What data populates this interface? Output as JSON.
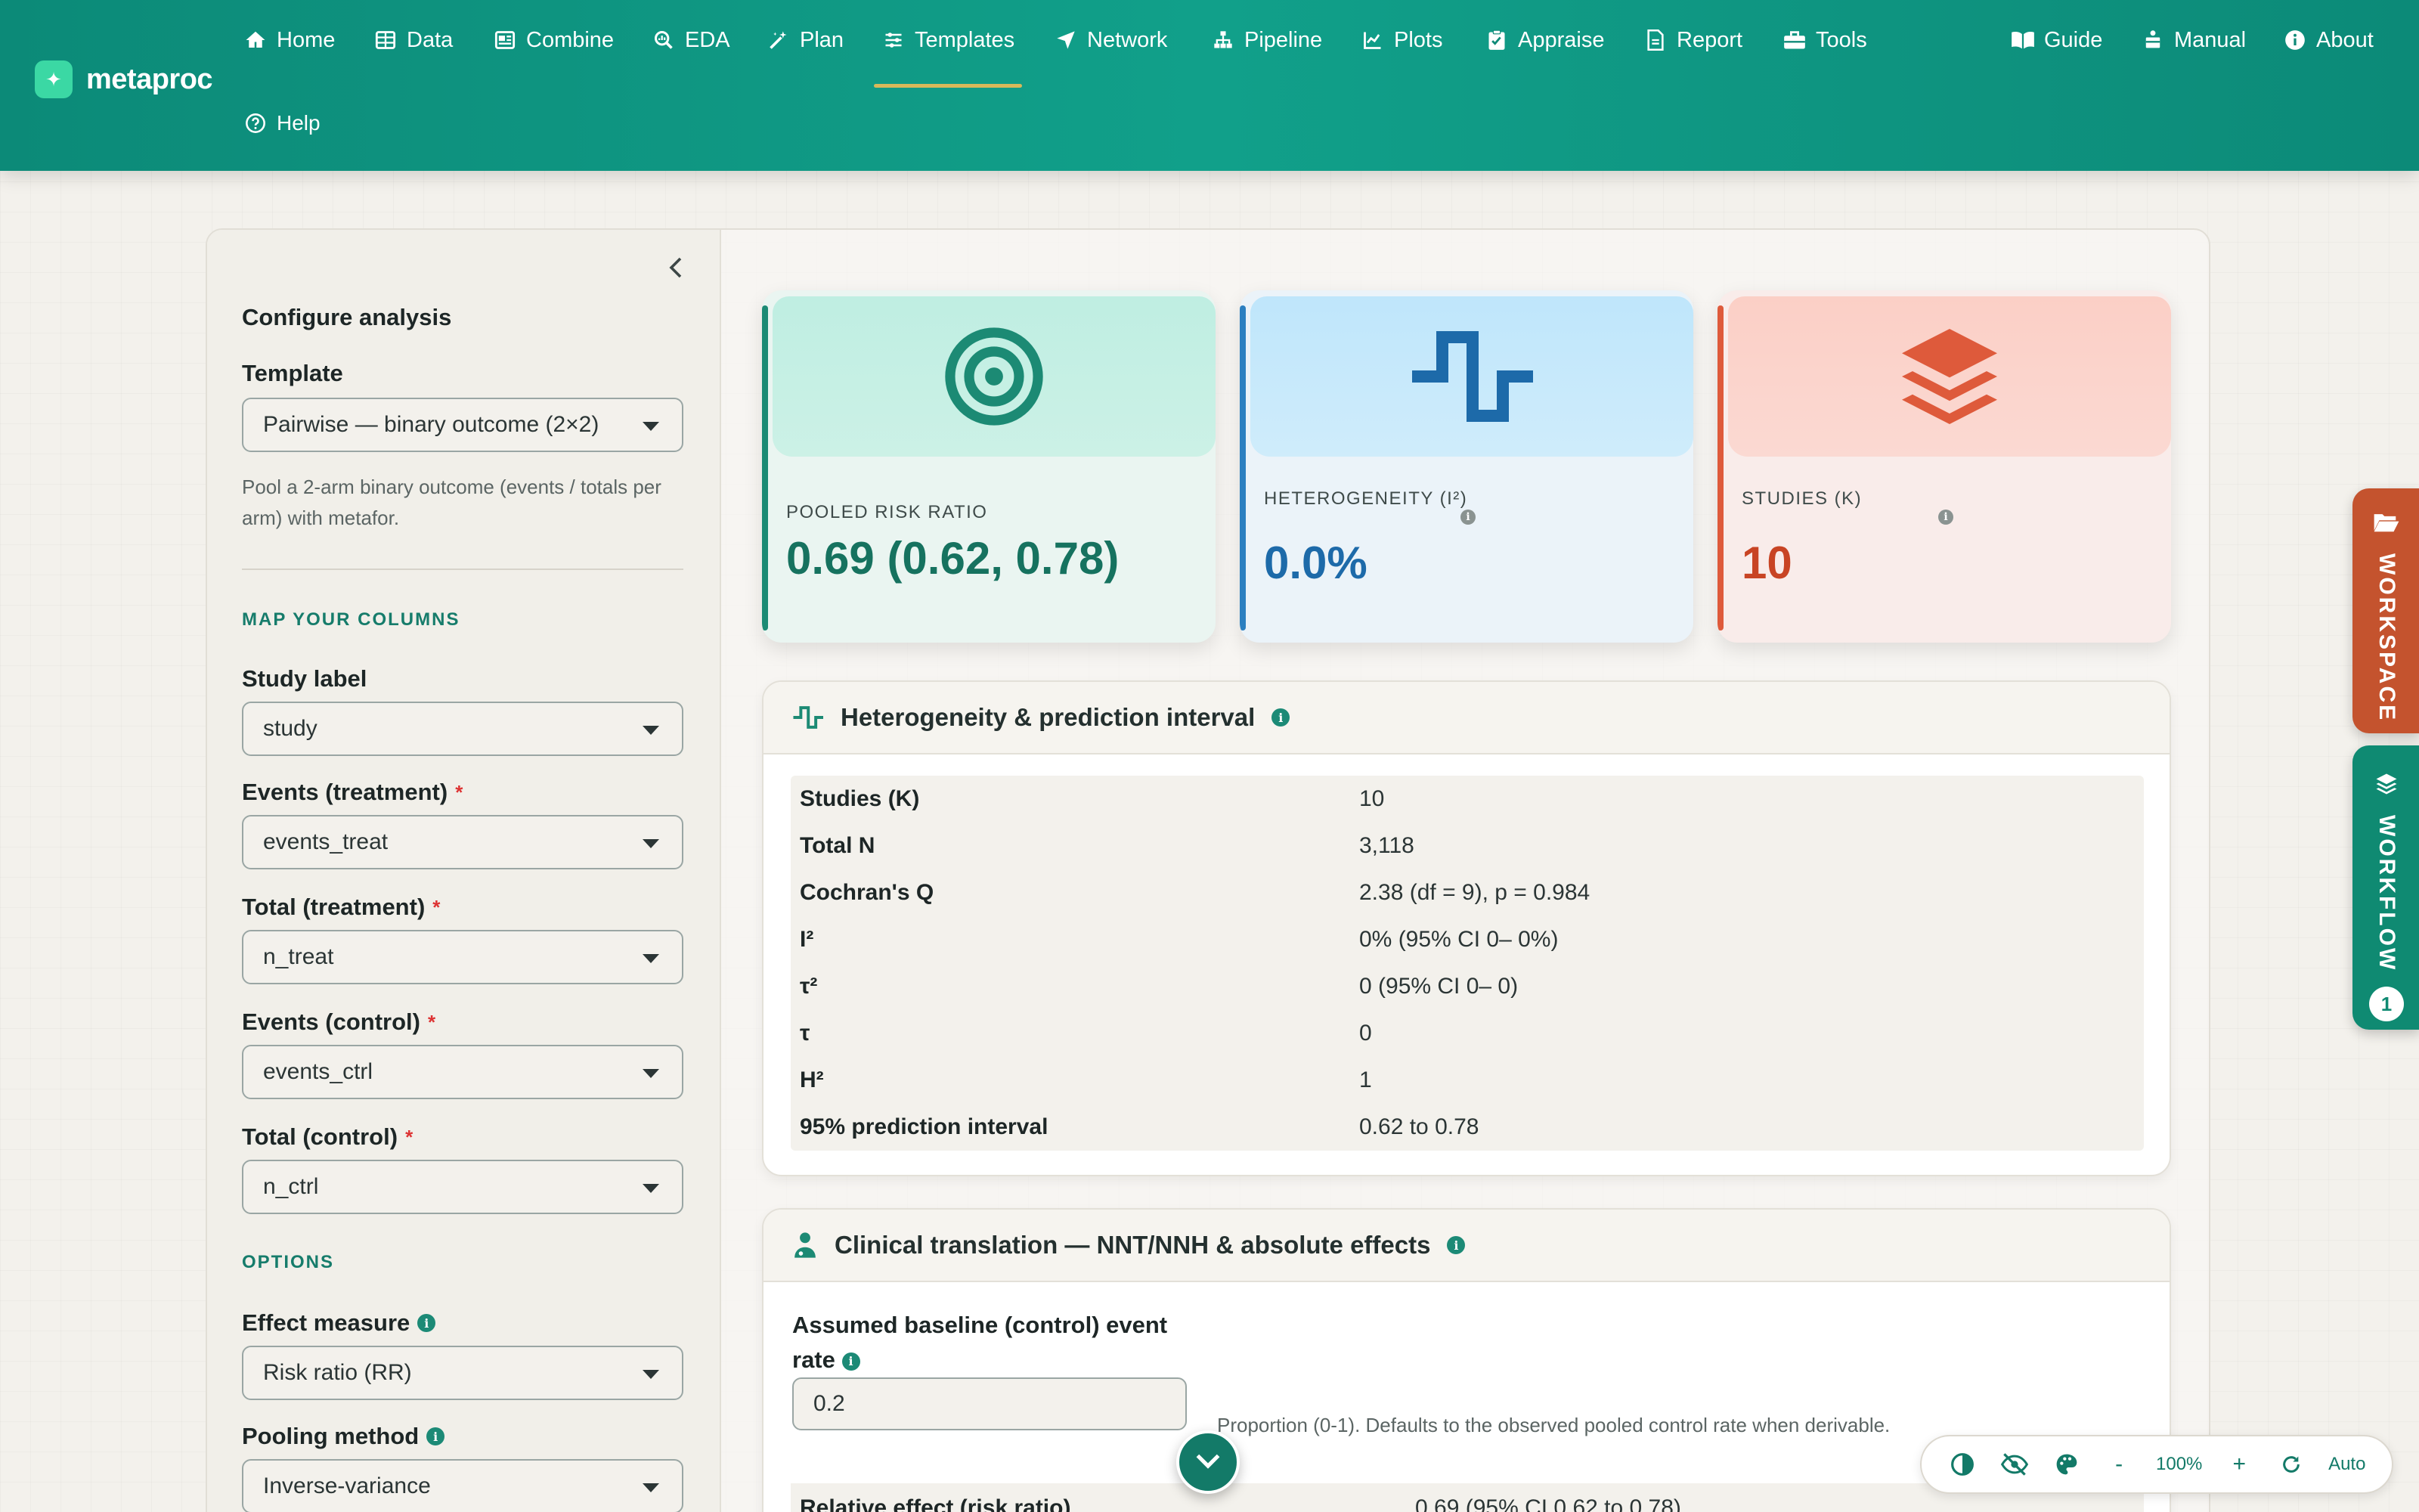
{
  "brand": {
    "name": "metaproc"
  },
  "nav": {
    "items": [
      {
        "label": "Home",
        "icon": "home-icon"
      },
      {
        "label": "Data",
        "icon": "table-icon"
      },
      {
        "label": "Combine",
        "icon": "combine-icon"
      },
      {
        "label": "EDA",
        "icon": "magnifier-chart-icon"
      },
      {
        "label": "Plan",
        "icon": "wand-icon"
      },
      {
        "label": "Templates",
        "icon": "sliders-icon",
        "active": true
      },
      {
        "label": "Network",
        "icon": "network-icon"
      },
      {
        "label": "Pipeline",
        "icon": "sitemap-icon"
      },
      {
        "label": "Plots",
        "icon": "line-chart-icon"
      },
      {
        "label": "Appraise",
        "icon": "clipboard-check-icon"
      },
      {
        "label": "Report",
        "icon": "document-icon"
      },
      {
        "label": "Tools",
        "icon": "toolbox-icon"
      },
      {
        "label": "Guide",
        "icon": "book-icon"
      },
      {
        "label": "Manual",
        "icon": "people-carry-icon"
      },
      {
        "label": "About",
        "icon": "info-icon"
      },
      {
        "label": "Help",
        "icon": "question-icon"
      }
    ]
  },
  "sidebar": {
    "title": "Configure analysis",
    "template": {
      "label": "Template",
      "value": "Pairwise — binary outcome (2×2)",
      "help": "Pool a 2-arm binary outcome (events / totals per arm) with metafor."
    },
    "map_caption": "MAP YOUR COLUMNS",
    "fields": [
      {
        "label": "Study label",
        "required": false,
        "value": "study"
      },
      {
        "label": "Events (treatment)",
        "required": true,
        "value": "events_treat"
      },
      {
        "label": "Total (treatment)",
        "required": true,
        "value": "n_treat"
      },
      {
        "label": "Events (control)",
        "required": true,
        "value": "events_ctrl"
      },
      {
        "label": "Total (control)",
        "required": true,
        "value": "n_ctrl"
      }
    ],
    "required_mark": "*",
    "options_caption": "OPTIONS",
    "options": [
      {
        "label": "Effect measure",
        "value": "Risk ratio (RR)"
      },
      {
        "label": "Pooling method",
        "value": "Inverse-variance"
      }
    ]
  },
  "cards": [
    {
      "caption": "POOLED RISK RATIO",
      "value": "0.69 (0.62, 0.78)",
      "icon": "target-icon"
    },
    {
      "caption": "HETEROGENEITY (I²)",
      "value": "0.0%",
      "icon": "wave-icon"
    },
    {
      "caption": "STUDIES (K)",
      "value": "10",
      "icon": "layers-icon"
    }
  ],
  "heterogeneity_panel": {
    "title": "Heterogeneity & prediction interval",
    "rows": [
      {
        "key": "Studies (K)",
        "value": "10"
      },
      {
        "key": "Total N",
        "value": "3,118"
      },
      {
        "key": "Cochran's Q",
        "value": "2.38 (df = 9), p = 0.984"
      },
      {
        "key": "I²",
        "value": "0% (95% CI 0– 0%)"
      },
      {
        "key": "τ²",
        "value": "0 (95% CI 0– 0)"
      },
      {
        "key": "τ",
        "value": "0"
      },
      {
        "key": "H²",
        "value": "1"
      },
      {
        "key": "95% prediction interval",
        "value": "0.62 to 0.78"
      }
    ]
  },
  "clinical_panel": {
    "title": "Clinical translation — NNT/NNH & absolute effects",
    "baseline_label": "Assumed baseline (control) event rate",
    "baseline_value": "0.2",
    "hint": "Proportion (0-1). Defaults to the observed pooled control rate when derivable.",
    "relative_key": "Relative effect (risk ratio)",
    "relative_value": "0.69 (95% CI 0.62 to 0.78)"
  },
  "side_tabs": {
    "workspace": "WORKSPACE",
    "workflow": "WORKFLOW",
    "workflow_badge": "1"
  },
  "toolbar": {
    "zoom_out": "-",
    "zoom": "100%",
    "zoom_in": "+",
    "mode": "Auto"
  }
}
